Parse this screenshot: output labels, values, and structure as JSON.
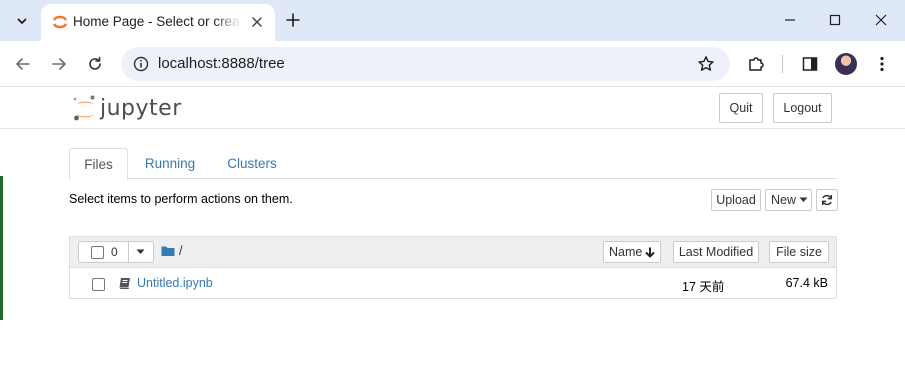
{
  "browser": {
    "tab_title": "Home Page - Select or create a notebook",
    "url": "localhost:8888/tree"
  },
  "jupyter": {
    "logo_text": "jupyter",
    "header_buttons": {
      "quit": "Quit",
      "logout": "Logout"
    },
    "tabs": [
      {
        "label": "Files",
        "active": true
      },
      {
        "label": "Running",
        "active": false
      },
      {
        "label": "Clusters",
        "active": false
      }
    ],
    "hint": "Select items to perform actions on them.",
    "actions": {
      "upload": "Upload",
      "new": "New"
    },
    "list_header": {
      "selected_count": "0",
      "breadcrumb": "/",
      "sort_name": "Name",
      "last_modified": "Last Modified",
      "file_size": "File size"
    },
    "items": [
      {
        "name": "Untitled.ipynb",
        "modified": "17 天前",
        "size": "67.4 kB",
        "icon": "book-icon"
      }
    ]
  },
  "colors": {
    "accent": "#337ab7",
    "tabstrip": "#dfe8f7",
    "jupyter_orange": "#f37626"
  }
}
